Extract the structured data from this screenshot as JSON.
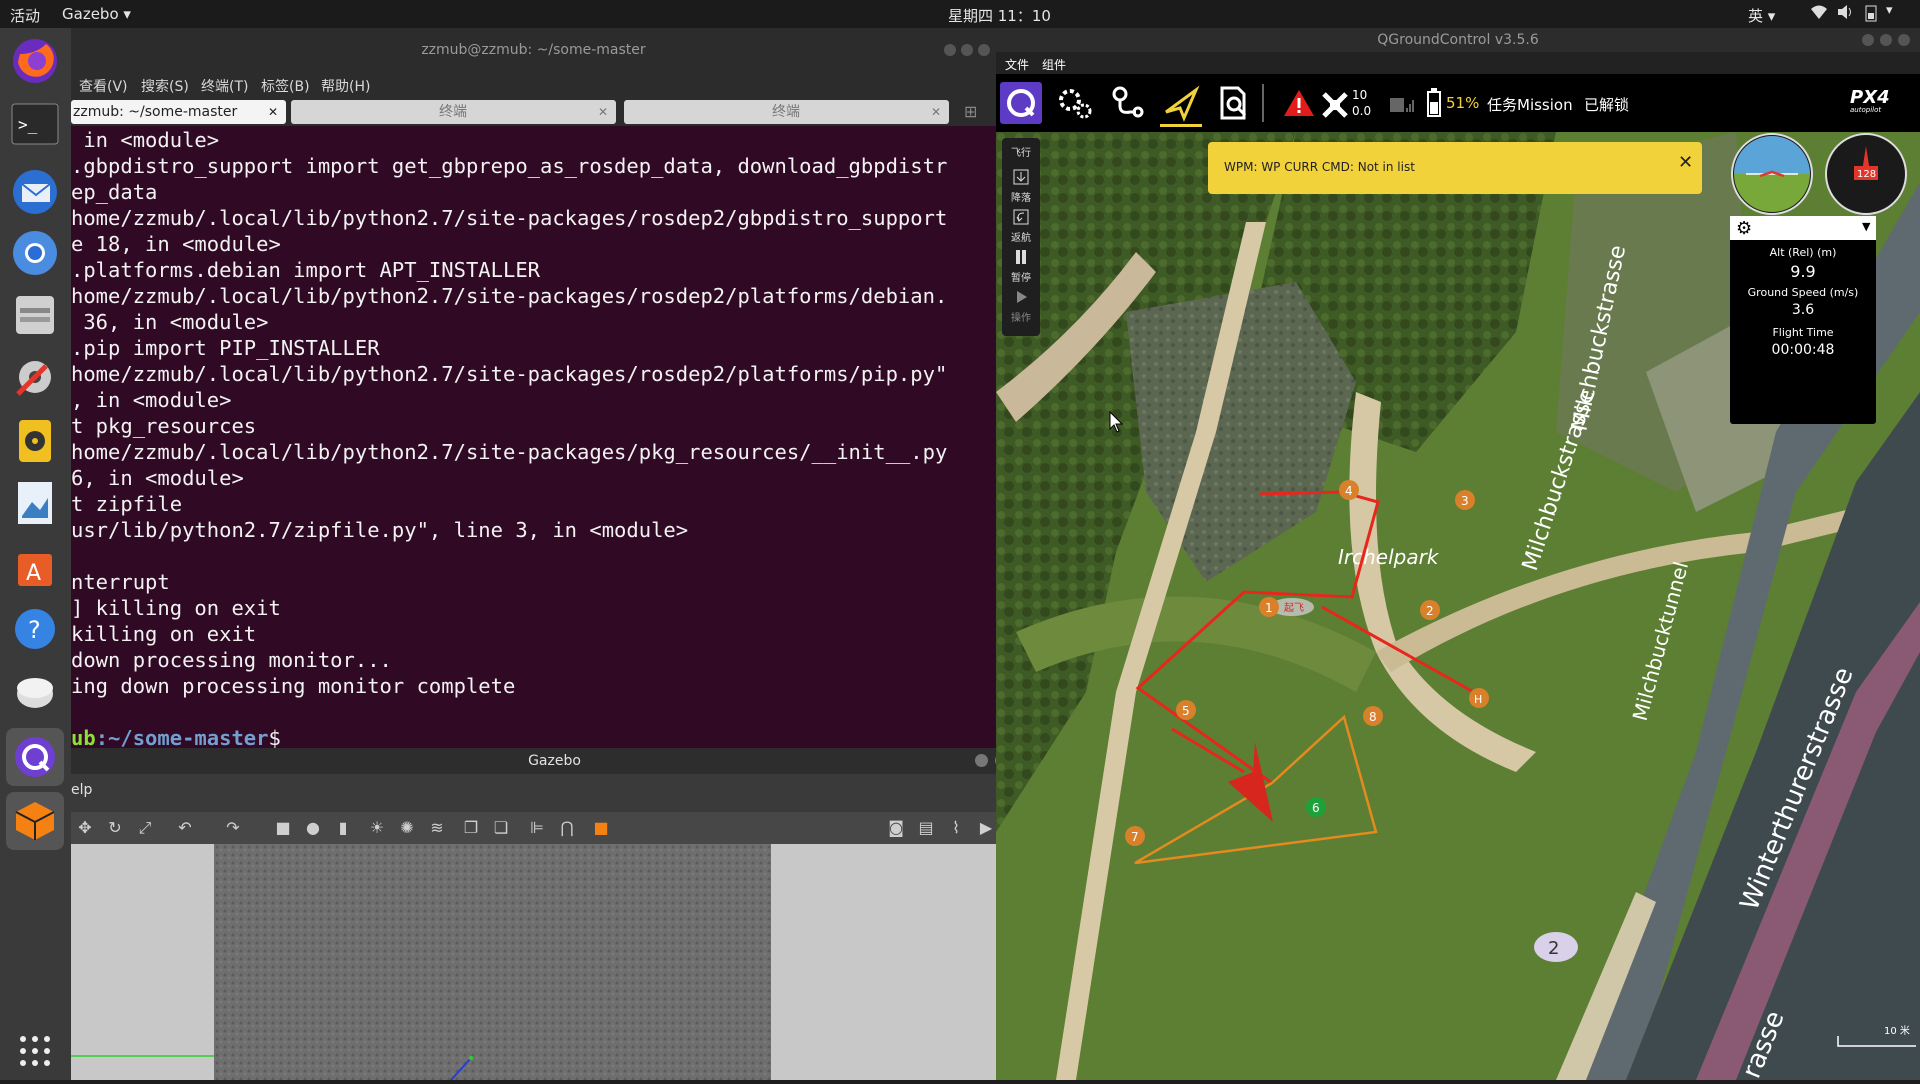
{
  "topbar": {
    "activities": "活动",
    "app": "Gazebo ▾",
    "clock": "星期四 11：10",
    "ime": "英 ▾"
  },
  "terminal": {
    "window_title": "zzmub@zzmub: ~/some-master",
    "menu": [
      "查看(V)",
      "搜索(S)",
      "终端(T)",
      "标签(B)",
      "帮助(H)"
    ],
    "tabs": [
      "zzmub: ~/some-master",
      "终端",
      "终端"
    ],
    "lines": [
      " in <module>",
      ".gbpdistro_support import get_gbprepo_as_rosdep_data, download_gbpdistr",
      "ep_data",
      "home/zzmub/.local/lib/python2.7/site-packages/rosdep2/gbpdistro_support",
      "e 18, in <module>",
      ".platforms.debian import APT_INSTALLER",
      "home/zzmub/.local/lib/python2.7/site-packages/rosdep2/platforms/debian.",
      " 36, in <module>",
      ".pip import PIP_INSTALLER",
      "home/zzmub/.local/lib/python2.7/site-packages/rosdep2/platforms/pip.py\"",
      ", in <module>",
      "t pkg_resources",
      "home/zzmub/.local/lib/python2.7/site-packages/pkg_resources/__init__.py",
      "6, in <module>",
      "t zipfile",
      "usr/lib/python2.7/zipfile.py\", line 3, in <module>",
      "",
      "nterrupt",
      "] killing on exit",
      "killing on exit",
      "down processing monitor...",
      "ing down processing monitor complete",
      "",
      ""
    ],
    "prompt_user": "ub",
    "prompt_path": ":~/some-master",
    "prompt_symbol": "$"
  },
  "gazebo": {
    "window_title": "Gazebo",
    "menu_fragment": "elp"
  },
  "qgc": {
    "window_title": "QGroundControl v3.5.6",
    "menu": [
      "文件",
      "组件"
    ],
    "gps_count": "10",
    "gps_hdop": "0.0",
    "battery": "51%",
    "mission_label": "任务Mission",
    "arm_state": "已解锁",
    "brand": "PX4",
    "brand_sub": "autopilot",
    "fly_buttons": [
      {
        "label": "飞行"
      },
      {
        "label": "降落"
      },
      {
        "label": "返航"
      },
      {
        "label": "暂停"
      },
      {
        "label": "操作"
      }
    ],
    "banner_text": "WPM: WP CURR CMD: Not in list",
    "banner_close": "✕",
    "alt_label": "Alt (Rel) (m)",
    "alt_value": "9.9",
    "gs_label": "Ground Speed (m/s)",
    "gs_value": "3.6",
    "ft_label": "Flight Time",
    "ft_value": "00:00:48",
    "compass_heading": "128",
    "map_labels": {
      "park": "Irchelpark",
      "street1": "Milchbuckstrasse",
      "tunnel": "Milchbucktunnel",
      "street2": "Winterthurerstrasse",
      "street3": "rasse",
      "road_no": "2",
      "scale": "10 米"
    },
    "waypoints": [
      "1",
      "2",
      "3",
      "4",
      "5",
      "6",
      "7",
      "8",
      "H"
    ],
    "takeoff_label": "起飞"
  },
  "colors": {
    "terminal_bg": "#300a24",
    "path_red": "#e8261c",
    "path_orange": "#e58a1e",
    "wp_orange": "#d9812a",
    "current_wp": "#1fa13a",
    "banner": "#f2d23a"
  }
}
